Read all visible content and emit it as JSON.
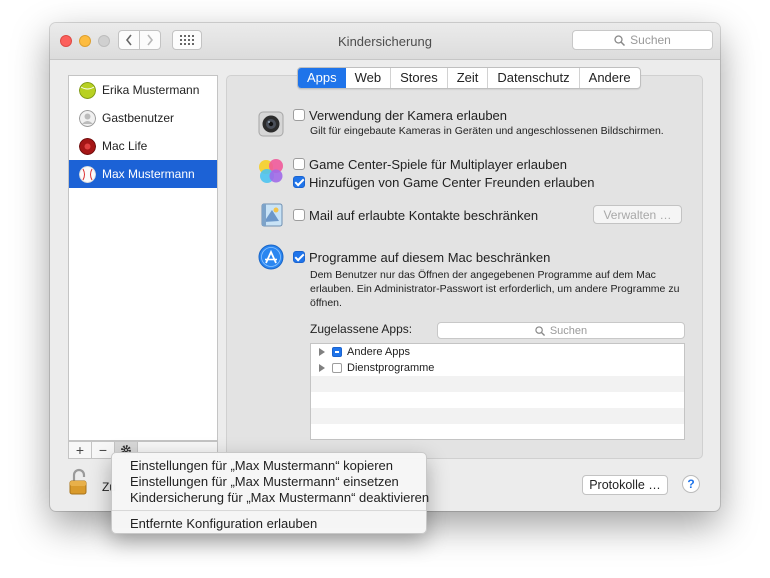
{
  "window": {
    "title": "Kindersicherung"
  },
  "toolbar": {
    "search_placeholder": "Suchen"
  },
  "users": [
    {
      "name": "Erika Mustermann",
      "selected": false
    },
    {
      "name": "Gastbenutzer",
      "selected": false
    },
    {
      "name": "Mac Life",
      "selected": false
    },
    {
      "name": "Max Mustermann",
      "selected": true
    }
  ],
  "sidebar_toolbar": {
    "add": "+",
    "remove": "−"
  },
  "tabs": [
    {
      "label": "Apps",
      "active": true
    },
    {
      "label": "Web",
      "active": false
    },
    {
      "label": "Stores",
      "active": false
    },
    {
      "label": "Zeit",
      "active": false
    },
    {
      "label": "Datenschutz",
      "active": false
    },
    {
      "label": "Andere",
      "active": false
    }
  ],
  "camera": {
    "label": "Verwendung der Kamera erlauben",
    "checked": false,
    "description": "Gilt für eingebaute Kameras in Geräten und angeschlossenen Bildschirmen."
  },
  "gamecenter": {
    "multiplayer_label": "Game Center-Spiele für Multiplayer erlauben",
    "multiplayer_checked": false,
    "friends_label": "Hinzufügen von Game Center Freunden erlauben",
    "friends_checked": true
  },
  "mail": {
    "label": "Mail auf erlaubte Kontakte beschränken",
    "checked": false,
    "manage_button": "Verwalten …"
  },
  "programs": {
    "label": "Programme auf diesem Mac beschränken",
    "checked": true,
    "description": "Dem Benutzer nur das Öffnen der angegebenen Programme auf dem Mac erlauben. Ein Administrator-Passwort ist erforderlich, um andere Programme zu öffnen.",
    "allowed_apps_label": "Zugelassene Apps:",
    "search_placeholder": "Suchen",
    "items": [
      {
        "label": "Andere Apps",
        "state": "mixed"
      },
      {
        "label": "Dienstprogramme",
        "state": "unchecked"
      }
    ]
  },
  "footer": {
    "lock_text": "Zu",
    "logs_button": "Protokolle …",
    "help": "?"
  },
  "context_menu": {
    "items": [
      "Einstellungen für „Max Mustermann“ kopieren",
      "Einstellungen für „Max Mustermann“ einsetzen",
      "Kindersicherung für „Max Mustermann“ deaktivieren"
    ],
    "extra_item": "Entfernte Konfiguration erlauben"
  },
  "colors": {
    "accent": "#1f74ea",
    "selection": "#1c62d6"
  }
}
